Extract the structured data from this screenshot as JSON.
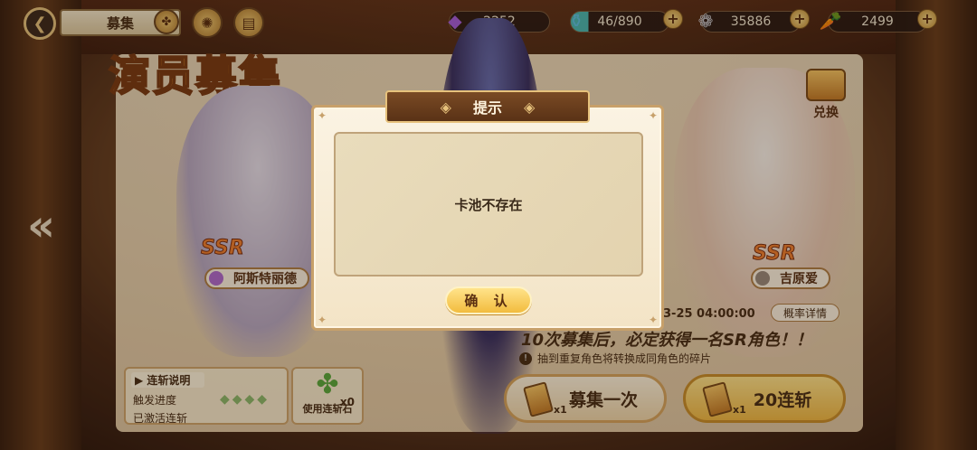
{
  "header": {
    "title": "募集",
    "resources": [
      {
        "icon": "purple-gem-icon",
        "value": "2252"
      },
      {
        "icon": "stamina-potion-icon",
        "value": "46/890"
      },
      {
        "icon": "silver-coin-icon",
        "value": "35886"
      },
      {
        "icon": "carrot-icon",
        "value": "2499"
      }
    ]
  },
  "banner": {
    "title": "演员募集",
    "exchange_label": "兑换",
    "left_char": {
      "rarity": "SSR",
      "name": "阿斯特丽德"
    },
    "right_char": {
      "rarity": "SSR",
      "name": "吉原爱"
    },
    "end_date": "3-25 04:00:00",
    "rate_details": "概率详情",
    "guarantee_text": "10次募集后，必定获得一名SR角色！！",
    "duplicate_note": "抽到重复角色将转换成同角色的碎片"
  },
  "combo": {
    "header": "连斩说明",
    "progress_label": "触发进度",
    "activated_label": "已激活连斩",
    "stone_label": "使用连斩石",
    "stone_count": "x0"
  },
  "draw": {
    "single_label": "募集一次",
    "single_count": "x1",
    "ten_label": "20连斩",
    "ten_count": "x1"
  },
  "dialog": {
    "title": "提示",
    "message": "卡池不存在",
    "confirm_label": "确 认"
  },
  "colors": {
    "accent": "#f2bc3e",
    "panel": "#fbf3e3",
    "header": "#5a3216"
  }
}
